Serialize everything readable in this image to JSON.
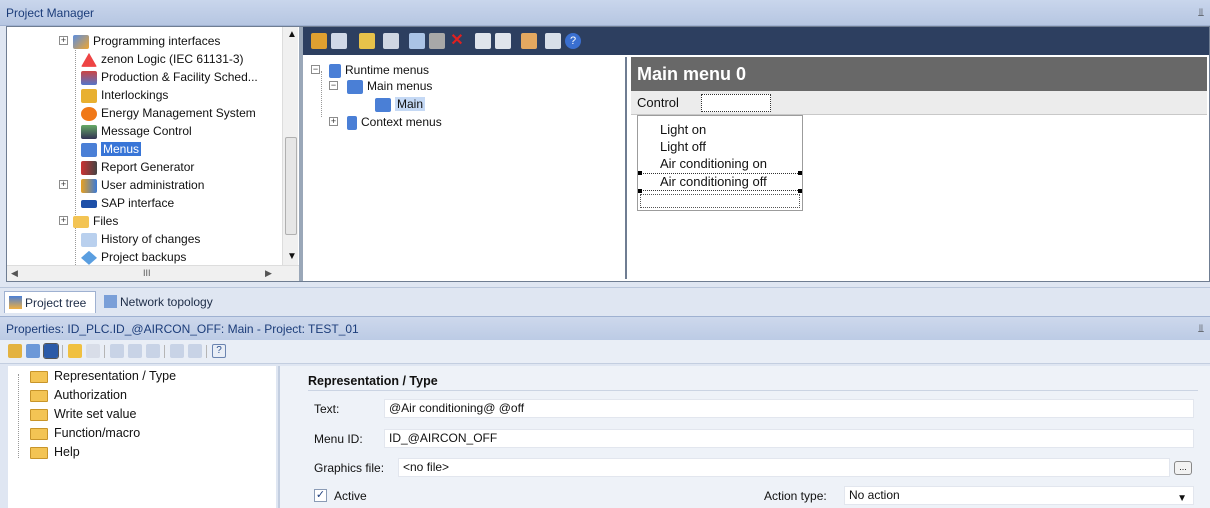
{
  "panels": {
    "project_manager_title": "Project Manager",
    "properties_title": "Properties: ID_PLC.ID_@AIRCON_OFF: Main - Project: TEST_01"
  },
  "project_tree": {
    "items": [
      {
        "label": "Programming interfaces",
        "icon": "programming-interfaces-icon"
      },
      {
        "label": "zenon Logic (IEC 61131-3)",
        "icon": "zenon-logic-icon"
      },
      {
        "label": "Production & Facility Sched...",
        "icon": "scheduler-icon"
      },
      {
        "label": "Interlockings",
        "icon": "lock-icon"
      },
      {
        "label": "Energy Management System",
        "icon": "energy-icon"
      },
      {
        "label": "Message Control",
        "icon": "message-control-icon"
      },
      {
        "label": "Menus",
        "icon": "menus-icon",
        "selected": true
      },
      {
        "label": "Report Generator",
        "icon": "report-icon"
      },
      {
        "label": "User administration",
        "icon": "users-icon"
      },
      {
        "label": "SAP interface",
        "icon": "sap-icon"
      },
      {
        "label": "Files",
        "icon": "folder-icon"
      },
      {
        "label": "History of changes",
        "icon": "history-icon"
      },
      {
        "label": "Project backups",
        "icon": "backup-icon"
      }
    ],
    "hscroll_grip": "III"
  },
  "menu_tree": {
    "runtime_menus": "Runtime menus",
    "main_menus": "Main menus",
    "main": "Main",
    "context_menus": "Context menus"
  },
  "preview": {
    "title": "Main menu 0",
    "control_label": "Control",
    "dropdown_items": [
      "Light on",
      "Light off",
      "Air conditioning on",
      "Air conditioning off"
    ]
  },
  "tabs": [
    {
      "label": "Project tree",
      "icon": "project-tree-icon"
    },
    {
      "label": "Network topology",
      "icon": "network-icon"
    }
  ],
  "categories": [
    "Representation / Type",
    "Authorization",
    "Write set value",
    "Function/macro",
    "Help"
  ],
  "form": {
    "section_title": "Representation / Type",
    "text_label": "Text:",
    "text_value": "@Air conditioning@ @off",
    "menu_id_label": "Menu ID:",
    "menu_id_value": "ID_@AIRCON_OFF",
    "graphics_label": "Graphics file:",
    "graphics_value": "<no file>",
    "browse_label": "...",
    "active_label": "Active",
    "active_checked": true,
    "action_label": "Action type:",
    "action_value": "No action"
  },
  "colors": {
    "selection": "#3875d7",
    "preview_title_bg": "#686868",
    "editor_toolbar_bg": "#2d3f60"
  }
}
